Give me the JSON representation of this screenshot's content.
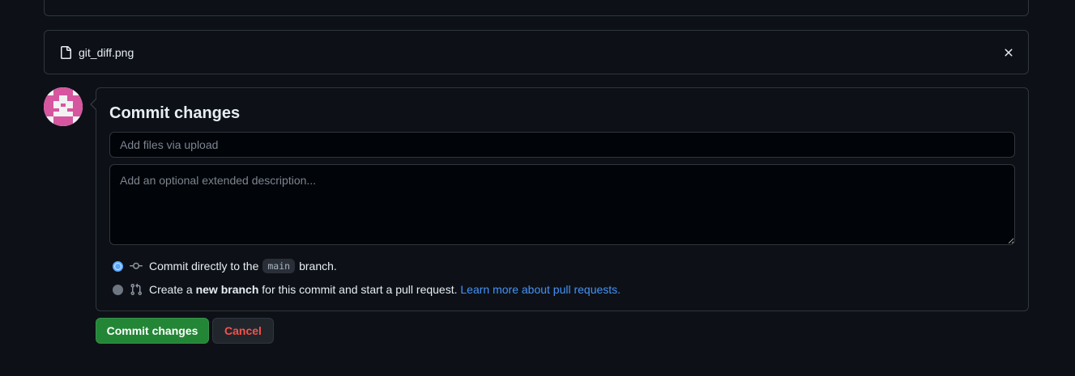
{
  "file": {
    "name": "git_diff.png",
    "icon": "file-icon",
    "close_icon": "x-icon"
  },
  "avatar": {
    "icon": "identicon-avatar",
    "color": "#d6569f"
  },
  "commit": {
    "title": "Commit changes",
    "summary_placeholder": "Add files via upload",
    "summary_value": "",
    "description_placeholder": "Add an optional extended description...",
    "description_value": "",
    "options": [
      {
        "icon": "git-commit-icon",
        "checked": true,
        "text_before": "Commit directly to the",
        "branch": "main",
        "text_after": "branch."
      },
      {
        "icon": "git-pull-request-icon",
        "checked": false,
        "text_before": "Create a",
        "bold": "new branch",
        "text_after": "for this commit and start a pull request.",
        "link": "Learn more about pull requests."
      }
    ]
  },
  "buttons": {
    "commit_label": "Commit changes",
    "cancel_label": "Cancel"
  },
  "colors": {
    "background": "#0d1117",
    "border": "#30363d",
    "accent": "#58a6ff",
    "link": "#4493f8",
    "primary_button": "#238636",
    "danger_text": "#f85149"
  }
}
